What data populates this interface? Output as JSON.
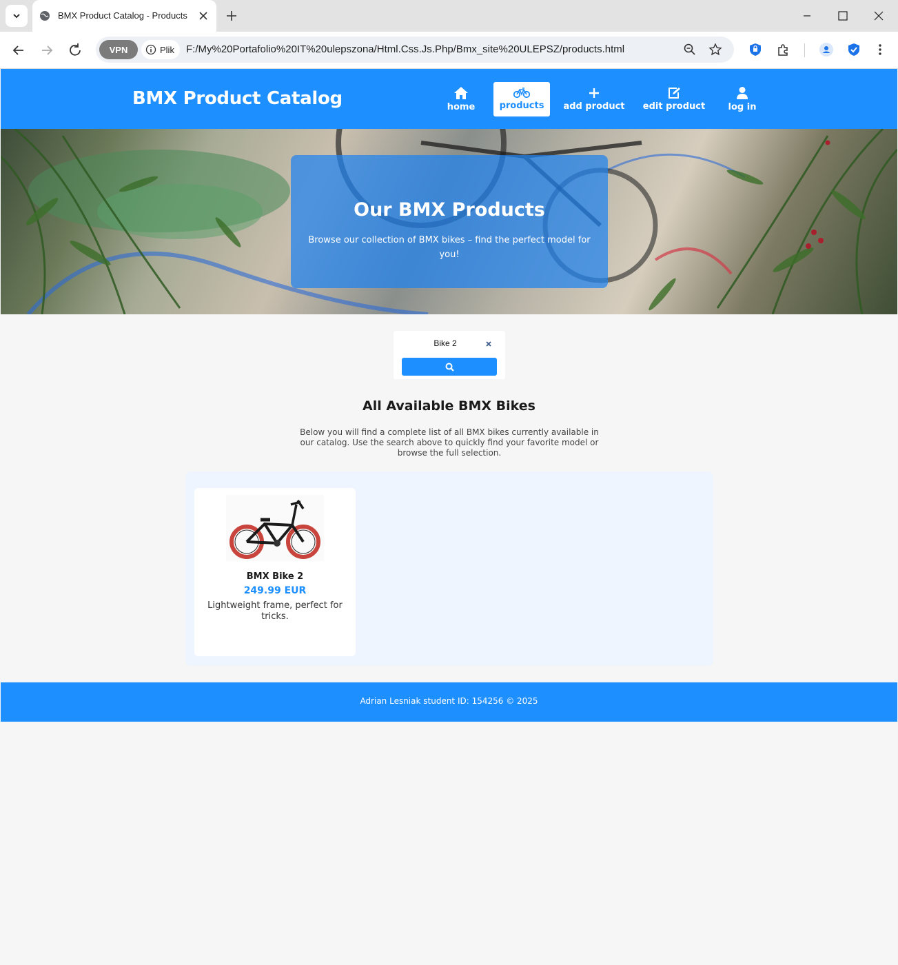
{
  "browser": {
    "tab_title": "BMX Product Catalog - Products",
    "vpn_label": "VPN",
    "file_chip": "Plik",
    "url": "F:/My%20Portafolio%20IT%20ulepszona/Html.Css.Js.Php/Bmx_site%20ULEPSZ/products.html"
  },
  "header": {
    "brand": "BMX Product Catalog",
    "nav": [
      {
        "label": "home",
        "icon": "home-icon"
      },
      {
        "label": "products",
        "icon": "bicycle-icon",
        "active": true
      },
      {
        "label": "add product",
        "icon": "plus-icon"
      },
      {
        "label": "edit product",
        "icon": "edit-icon"
      },
      {
        "label": "log in",
        "icon": "user-icon"
      }
    ]
  },
  "hero": {
    "title": "Our BMX Products",
    "subtitle": "Browse our collection of BMX bikes – find the perfect model for you!"
  },
  "search": {
    "value": "Bike 2"
  },
  "section": {
    "title": "All Available BMX Bikes",
    "description": "Below you will find a complete list of all BMX bikes currently available in our catalog. Use the search above to quickly find your favorite model or browse the full selection."
  },
  "products": [
    {
      "name": "BMX Bike 2",
      "price": "249.99 EUR",
      "description": "Lightweight frame, perfect for tricks."
    }
  ],
  "footer": {
    "text": "Adrian Lesniak student ID: 154256 © 2025"
  },
  "colors": {
    "brand_blue": "#1e8fff",
    "page_bg": "#f6f6f6",
    "products_bg": "#eef5ff"
  }
}
